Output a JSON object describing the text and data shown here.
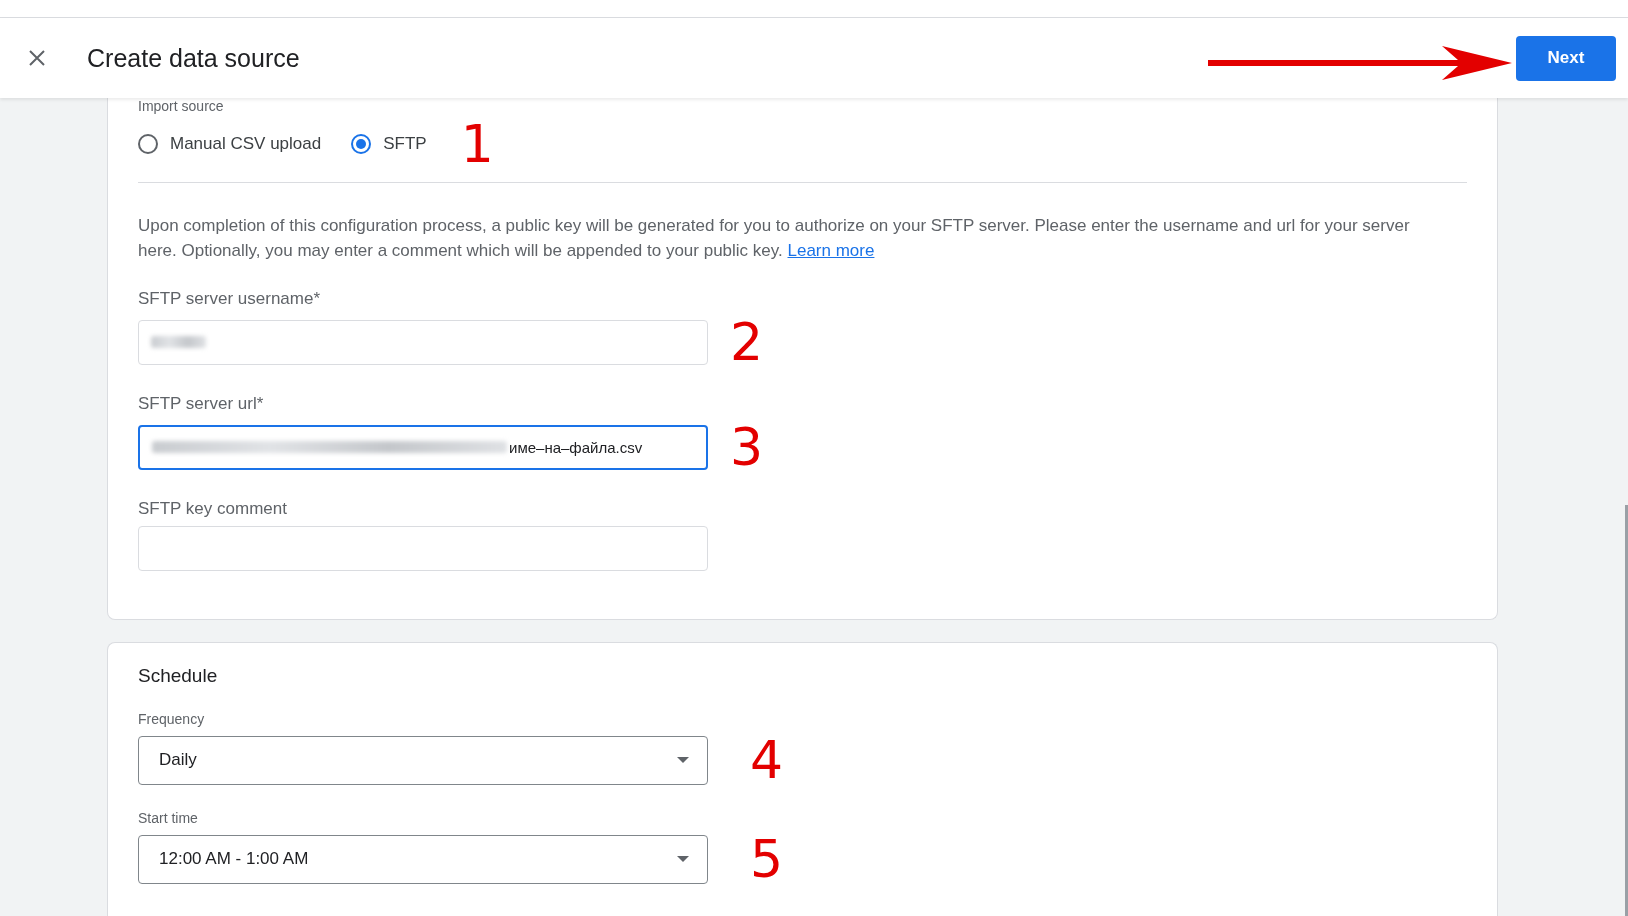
{
  "header": {
    "title": "Create data source",
    "next_button": "Next"
  },
  "import_source": {
    "label": "Import source",
    "annotation": "1",
    "options": [
      {
        "label": "Manual CSV upload",
        "selected": false
      },
      {
        "label": "SFTP",
        "selected": true
      }
    ]
  },
  "description": {
    "text": "Upon completion of this configuration process, a public key will be generated for you to authorize on your SFTP server. Please enter the username and url for your server here. Optionally, you may enter a comment which will be appended to your public key.",
    "link": "Learn more"
  },
  "fields": [
    {
      "label": "SFTP server username*",
      "redacted": true,
      "focused": false,
      "annotation": "2"
    },
    {
      "label": "SFTP server url*",
      "value": "име–на–файла.csv",
      "redacted": true,
      "focused": true,
      "annotation": "3"
    },
    {
      "label": "SFTP key comment",
      "redacted": false,
      "focused": false
    }
  ],
  "schedule": {
    "title": "Schedule",
    "selects": [
      {
        "label": "Frequency",
        "value": "Daily",
        "annotation": "4"
      },
      {
        "label": "Start time",
        "value": "12:00 AM - 1:00 AM",
        "annotation": "5"
      }
    ]
  }
}
